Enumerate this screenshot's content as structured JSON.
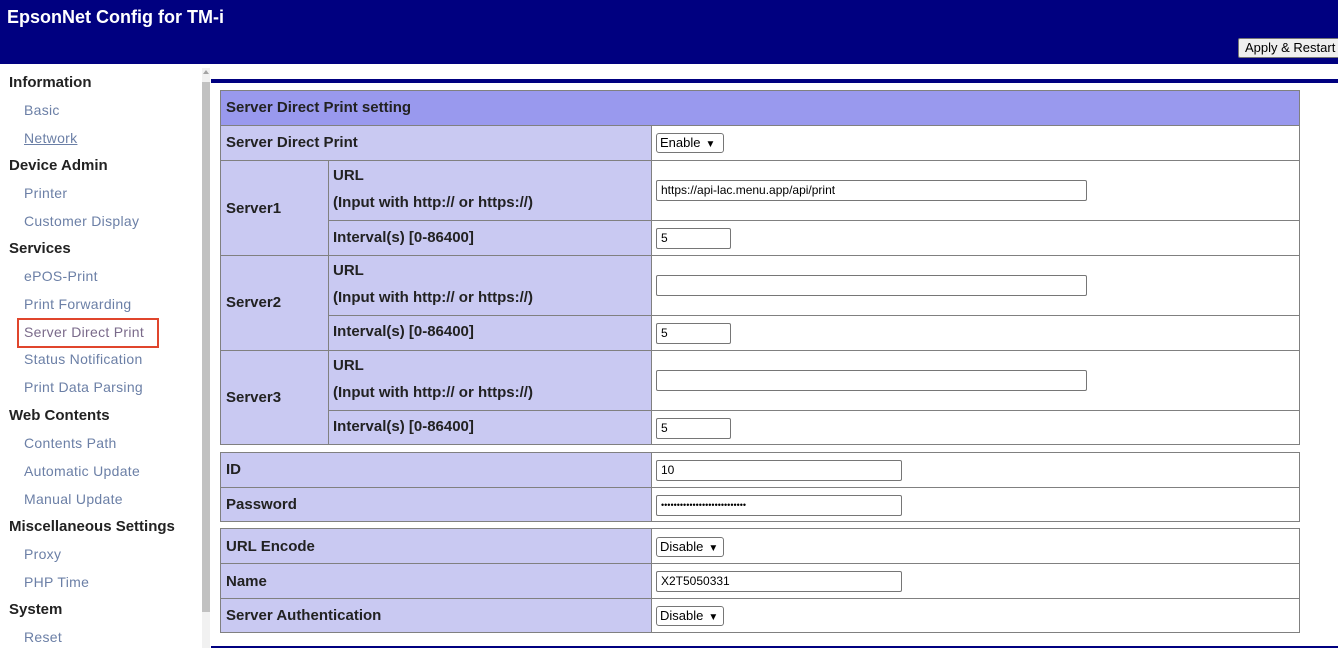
{
  "app": {
    "title": "EpsonNet Config for TM-i",
    "apply_label": "Apply & Restart"
  },
  "sidebar": {
    "groups": [
      {
        "label": "Information",
        "items": [
          {
            "label": "Basic"
          },
          {
            "label": "Network"
          }
        ]
      },
      {
        "label": "Device Admin",
        "items": [
          {
            "label": "Printer"
          },
          {
            "label": "Customer Display"
          }
        ]
      },
      {
        "label": "Services",
        "items": [
          {
            "label": "ePOS-Print"
          },
          {
            "label": "Print Forwarding"
          },
          {
            "label": "Server Direct Print"
          },
          {
            "label": "Status Notification"
          },
          {
            "label": "Print Data Parsing"
          }
        ]
      },
      {
        "label": "Web Contents",
        "items": [
          {
            "label": "Contents Path"
          },
          {
            "label": "Automatic Update"
          },
          {
            "label": "Manual Update"
          }
        ]
      },
      {
        "label": "Miscellaneous Settings",
        "items": [
          {
            "label": "Proxy"
          },
          {
            "label": "PHP Time"
          }
        ]
      },
      {
        "label": "System",
        "items": [
          {
            "label": "Reset"
          }
        ]
      }
    ]
  },
  "section": {
    "title": "Server Direct Print setting"
  },
  "server_direct_print": {
    "label": "Server Direct Print",
    "value": "Enable"
  },
  "servers": [
    {
      "label": "Server1",
      "url_label": "URL",
      "url_hint": "(Input with http:// or https://)",
      "url_value": "https://api-lac.menu.app/api/print",
      "interval_label": "Interval(s) [0-86400]",
      "interval_value": "5"
    },
    {
      "label": "Server2",
      "url_label": "URL",
      "url_hint": "(Input with http:// or https://)",
      "url_value": "",
      "interval_label": "Interval(s) [0-86400]",
      "interval_value": "5"
    },
    {
      "label": "Server3",
      "url_label": "URL",
      "url_hint": "(Input with http:// or https://)",
      "url_value": "",
      "interval_label": "Interval(s) [0-86400]",
      "interval_value": "5"
    }
  ],
  "auth": {
    "id_label": "ID",
    "id_value": "10",
    "password_label": "Password",
    "password_value": "•••••••••••••••••••••••••••"
  },
  "misc": {
    "url_encode_label": "URL Encode",
    "url_encode_value": "Disable",
    "name_label": "Name",
    "name_value": "X2T5050331",
    "server_auth_label": "Server Authentication",
    "server_auth_value": "Disable"
  },
  "colors": {
    "header": "#000080",
    "section_header": "#9999ee",
    "label_cell": "#cacaf4",
    "selected_outline": "#e0452c"
  }
}
